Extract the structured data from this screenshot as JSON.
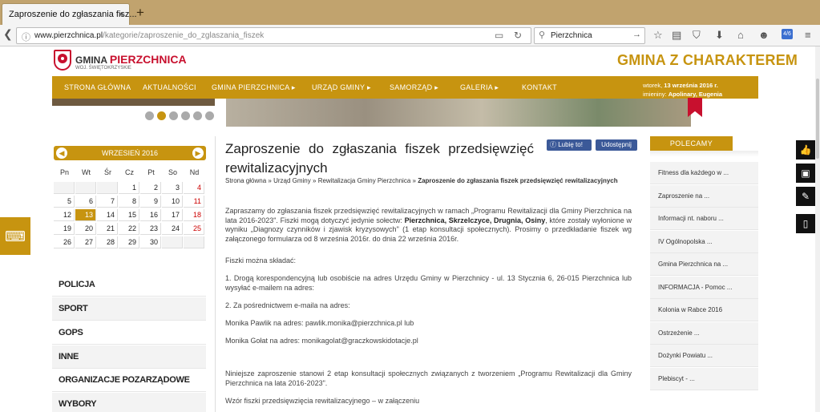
{
  "browser": {
    "tab_title": "Zaproszenie do zgłaszania fisz...",
    "tab_close": "×",
    "new_tab": "+",
    "url_host": "www.pierzchnica.pl",
    "url_path": "/kategorie/zaproszenie_do_zglaszania_fiszek",
    "search_value": "Pierzchnica",
    "badge": "4/6"
  },
  "header": {
    "logo_prefix": "GMINA",
    "logo_brand": "PIERZCHNICA",
    "logo_sub": "WOJ. ŚWIĘTOKRZYSKIE",
    "motto": "GMINA Z CHARAKTEREM"
  },
  "menu": {
    "items": [
      {
        "label": "STRONA GŁÓWNA"
      },
      {
        "label": "AKTUALNOŚCI"
      },
      {
        "label": "GMINA PIERZCHNICA ▸"
      },
      {
        "label": "URZĄD GMINY ▸"
      },
      {
        "label": "SAMORZĄD ▸"
      },
      {
        "label": "GALERIA ▸"
      },
      {
        "label": "KONTAKT"
      }
    ],
    "date_prefix": "wtorek,",
    "date": "13 września 2016 r.",
    "nameday_prefix": "imieniny:",
    "nameday": "Apolinary, Eugenia"
  },
  "calendar": {
    "month": "WRZESIEŃ 2016",
    "prev": "◀",
    "next": "▶",
    "dows": [
      "Pn",
      "Wt",
      "Śr",
      "Cz",
      "Pt",
      "So",
      "Nd"
    ],
    "cells": [
      "",
      "",
      "",
      "1",
      "2",
      "3",
      "4",
      "5",
      "6",
      "7",
      "8",
      "9",
      "10",
      "11",
      "12",
      "13",
      "14",
      "15",
      "16",
      "17",
      "18",
      "19",
      "20",
      "21",
      "22",
      "23",
      "24",
      "25",
      "26",
      "27",
      "28",
      "29",
      "30",
      "",
      ""
    ],
    "today": "13"
  },
  "sidebar": {
    "items": [
      {
        "label": "POLICJA"
      },
      {
        "label": "SPORT"
      },
      {
        "label": "GOPS"
      },
      {
        "label": "INNE"
      },
      {
        "label": "ORGANIZACJE POZARZĄDOWE"
      },
      {
        "label": "WYBORY"
      }
    ]
  },
  "article": {
    "title": "Zaproszenie do zgłaszania fiszek przedsięwzięć rewitalizacyjnych",
    "like": "Lubię to!",
    "share": "Udostępnij",
    "breadcrumb": {
      "home": "Strona główna",
      "sep": "»",
      "c1": "Urząd Gminy",
      "c2": "Rewitalizacja Gminy Pierzchnica",
      "current": "Zaproszenie do zgłaszania fiszek przedsięwzięć rewitalizacyjnych"
    },
    "p1_a": "Zapraszamy do zgłaszania fiszek przedsięwzięć rewitalizacyjnych w ramach „Programu Rewitalizacji dla Gminy Pierzchnica na lata 2016-2023\". Fiszki mogą dotyczyć jedynie sołectw:",
    "p1_b": "Pierzchnica, Skrzelczyce, Drugnia, Osiny",
    "p1_c": ", które zostały wyłonione w wyniku „Diagnozy czynników i zjawisk kryzysowych\" (1 etap konsultacji społecznych). Prosimy o przedkładanie fiszek wg załączonego formularza od 8 września 2016r. do dnia 22 września 2016r.",
    "p2": "Fiszki można składać:",
    "p3": "1. Drogą korespondencyjną lub osobiście na adres Urzędu Gminy w Pierzchnicy - ul. 13 Stycznia 6, 26-015 Pierzchnica lub wysyłać e-mailem na adres:",
    "p4": "2. Za pośrednictwem e-maila na adres:",
    "p5": "Monika Pawlik na adres: pawlik.monika@pierzchnica.pl lub",
    "p6": "Monika Gołat na adres: monikagolat@graczkowskidotacje.pl",
    "p7": "Niniejsze zaproszenie stanowi 2 etap konsultacji społecznych związanych z tworzeniem „Programu Rewitalizacji dla Gminy Pierzchnica na lata 2016-2023\".",
    "p8": "Wzór fiszki przedsięwzięcia rewitalizacyjnego – w załączeniu"
  },
  "recommended": {
    "title": "POLECAMY",
    "items": [
      {
        "label": "Fitness dla każdego w ..."
      },
      {
        "label": "Zaproszenie na ..."
      },
      {
        "label": "Informacji nt. naboru ..."
      },
      {
        "label": "IV Ogólnopolska ..."
      },
      {
        "label": "Gmina Pierzchnica na ..."
      },
      {
        "label": "INFORMACJA - Pomoc ..."
      },
      {
        "label": "Kolonia w Rabce 2016"
      },
      {
        "label": "Ostrzeżenie ..."
      },
      {
        "label": "Dożynki Powiatu ..."
      },
      {
        "label": "Plebiscyt - ..."
      }
    ]
  },
  "colors": {
    "accent": "#c79410",
    "brand_red": "#c8102e",
    "facebook": "#3b5998"
  }
}
